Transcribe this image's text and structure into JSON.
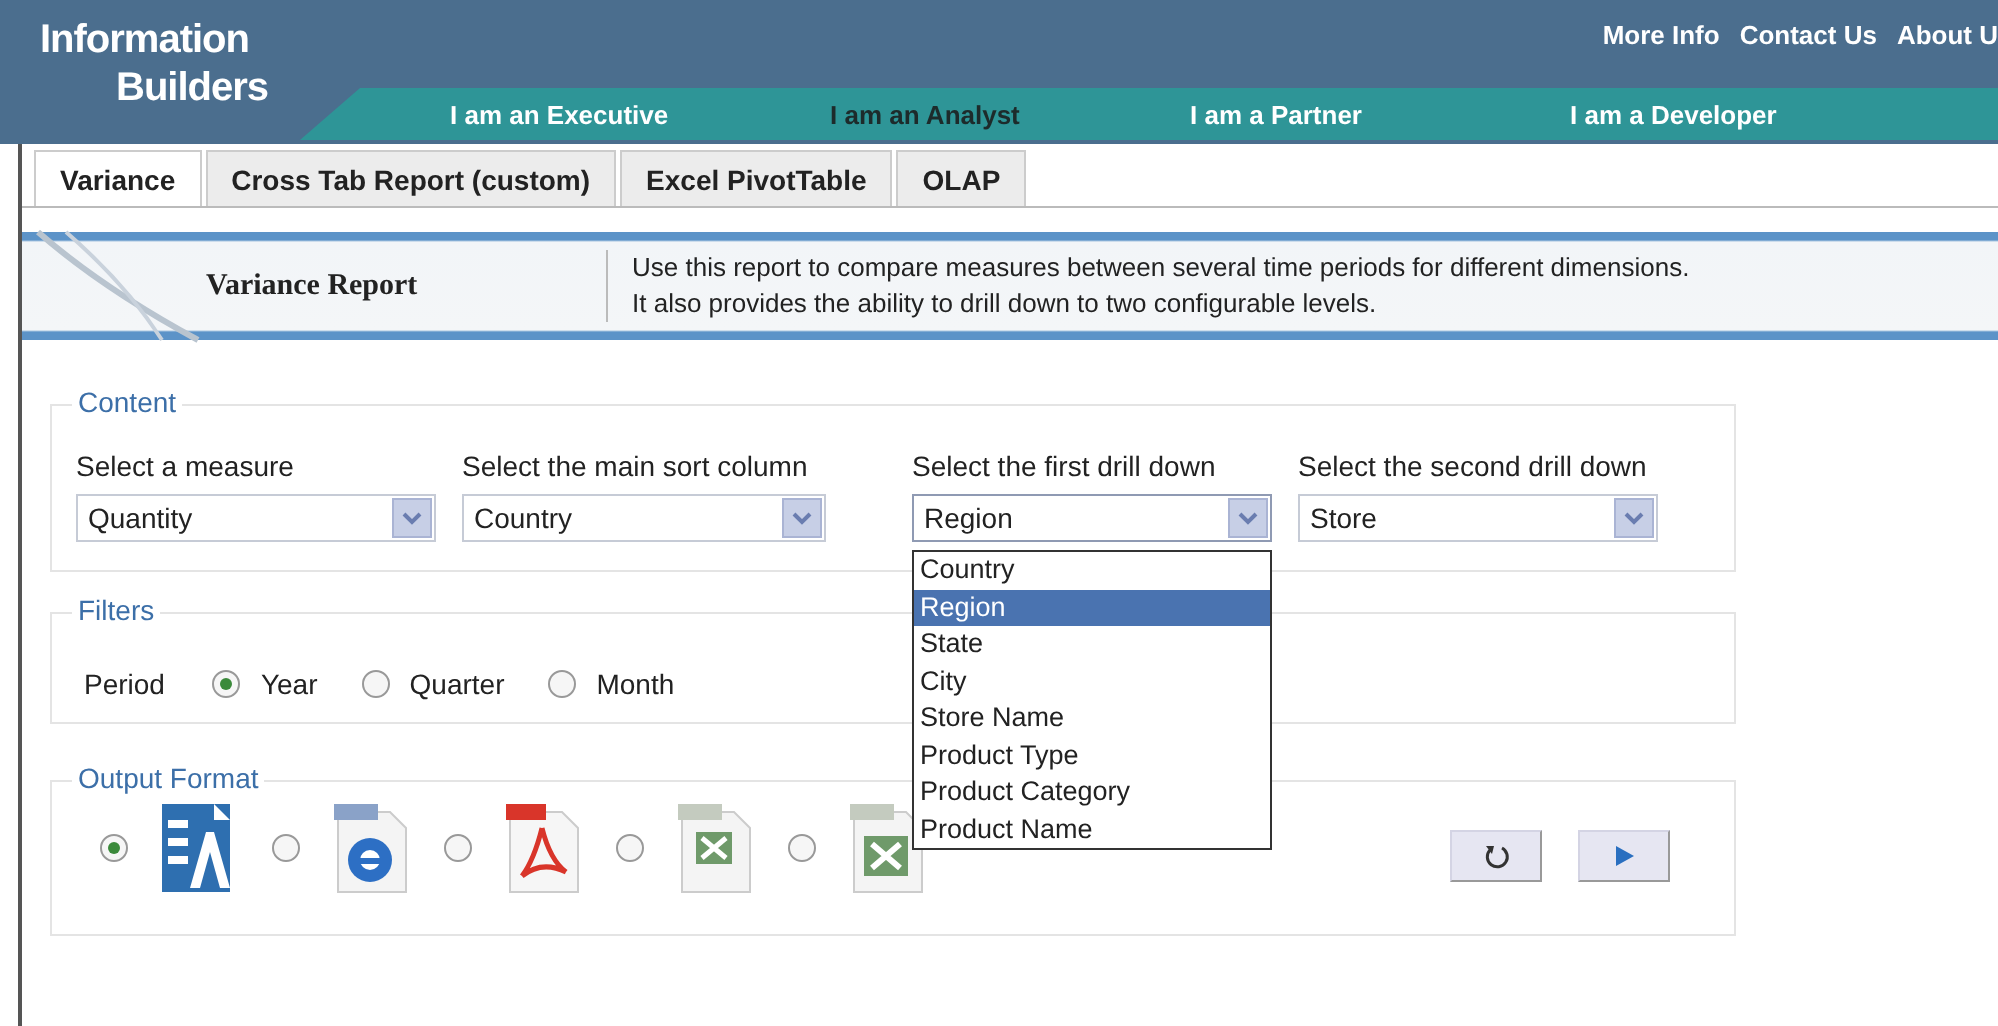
{
  "logo": {
    "line1": "Information",
    "line2": "Builders"
  },
  "top_links": [
    "More Info",
    "Contact Us",
    "About U"
  ],
  "nav": [
    {
      "label": "I am an Executive",
      "selected": false
    },
    {
      "label": "I am an Analyst",
      "selected": true
    },
    {
      "label": "I am a Partner",
      "selected": false
    },
    {
      "label": "I am a Developer",
      "selected": false
    }
  ],
  "tabs": [
    {
      "label": "Variance",
      "selected": true
    },
    {
      "label": "Cross Tab Report (custom)",
      "selected": false
    },
    {
      "label": "Excel PivotTable",
      "selected": false
    },
    {
      "label": "OLAP",
      "selected": false
    }
  ],
  "banner": {
    "title": "Variance Report",
    "description": [
      "Use this report to compare measures between several time periods for different dimensions.",
      "It also provides the ability to drill down to two configurable levels."
    ]
  },
  "content": {
    "legend": "Content",
    "selects": [
      {
        "label": "Select a measure",
        "value": "Quantity"
      },
      {
        "label": "Select the main sort column",
        "value": "Country"
      },
      {
        "label": "Select the first drill down",
        "value": "Region",
        "expanded": true,
        "options": [
          {
            "label": "Country",
            "selected": false
          },
          {
            "label": "Region",
            "selected": true
          },
          {
            "label": "State",
            "selected": false
          },
          {
            "label": "City",
            "selected": false
          },
          {
            "label": "Store Name",
            "selected": false
          },
          {
            "label": "Product Type",
            "selected": false
          },
          {
            "label": "Product Category",
            "selected": false
          },
          {
            "label": "Product Name",
            "selected": false
          }
        ]
      },
      {
        "label": "Select the second drill down",
        "value": "Store",
        "expanded": false
      }
    ]
  },
  "filters": {
    "legend": "Filters",
    "period_label": "Period",
    "periods": [
      {
        "label": "Year",
        "selected": true
      },
      {
        "label": "Quarter",
        "selected": false
      },
      {
        "label": "Month",
        "selected": false
      }
    ]
  },
  "output": {
    "legend": "Output Format",
    "formats": [
      {
        "kind": "report",
        "selected": true
      },
      {
        "kind": "html",
        "selected": false
      },
      {
        "kind": "pdf",
        "selected": false
      },
      {
        "kind": "excel",
        "selected": false
      },
      {
        "kind": "excel_sheet",
        "selected": false
      }
    ]
  }
}
